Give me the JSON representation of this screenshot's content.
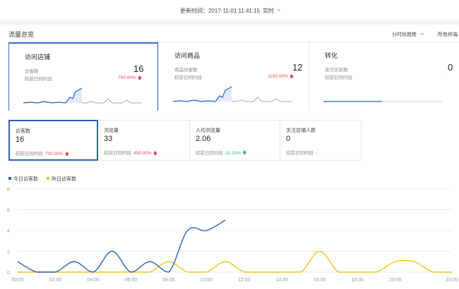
{
  "header": {
    "update_time": "更新时间：2017-11-01 11:41:15",
    "realtime_label": "实时"
  },
  "section": {
    "title": "流量总览",
    "trend_select": "分时段趋势",
    "terminal_select": "所有终端"
  },
  "cards": [
    {
      "title": "访问店铺",
      "metric_label": "访客数",
      "compare_label": "较前日同时段",
      "value": "16",
      "change": "700.00%"
    },
    {
      "title": "访问商品",
      "metric_label": "商品访客数",
      "compare_label": "较前日同时段",
      "value": "12",
      "change": "1100.00%"
    },
    {
      "title": "转化",
      "metric_label": "支付买家数",
      "compare_label": "较前日同时段",
      "value": "0",
      "change": "-"
    }
  ],
  "metrics": [
    {
      "label": "访客数",
      "value": "16",
      "compare_label": "较前日同时段",
      "change": "700.00%"
    },
    {
      "label": "浏览量",
      "value": "33",
      "compare_label": "较前日同时段",
      "change": "450.00%"
    },
    {
      "label": "人均浏览量",
      "value": "2.06",
      "compare_label": "较前日同时段",
      "change": "31.25%"
    },
    {
      "label": "关注店铺人数",
      "value": "0",
      "compare_label": "较前日同时段",
      "change": "-"
    }
  ],
  "colors": {
    "today": "#2b5fc0",
    "yesterday": "#f0c419",
    "up": "#e0474c",
    "down": "#2fb69f",
    "accent": "#3b6fd6"
  },
  "chart_data": {
    "type": "line",
    "x": [
      "00:00",
      "01:00",
      "02:00",
      "03:00",
      "04:00",
      "05:00",
      "06:00",
      "07:00",
      "08:00",
      "09:00",
      "10:00",
      "11:00",
      "12:00",
      "13:00",
      "14:00",
      "15:00",
      "16:00",
      "17:00",
      "18:00",
      "19:00",
      "20:00",
      "21:00",
      "22:00",
      "23:00"
    ],
    "x_tick_labels": [
      "00:00",
      "02:00",
      "04:00",
      "06:00",
      "08:00",
      "10:00",
      "12:00",
      "14:00",
      "16:00",
      "18:00",
      "20:00",
      "23:00"
    ],
    "y_ticks": [
      0,
      2,
      4,
      6,
      8
    ],
    "ylim": [
      0,
      8
    ],
    "grid": true,
    "legend_position": "top-left",
    "series": [
      {
        "name": "今日访客数",
        "values": [
          1,
          0,
          0,
          1,
          0,
          2,
          0,
          1,
          0,
          4,
          4,
          5,
          null,
          null,
          null,
          null,
          null,
          null,
          null,
          null,
          null,
          null,
          null,
          null
        ]
      },
      {
        "name": "昨日访客数",
        "values": [
          0,
          0,
          0,
          0,
          0,
          0,
          0,
          0,
          1,
          0,
          0,
          1,
          0,
          0,
          0,
          0,
          2,
          0,
          0,
          0,
          1,
          1,
          0,
          0
        ]
      }
    ]
  }
}
